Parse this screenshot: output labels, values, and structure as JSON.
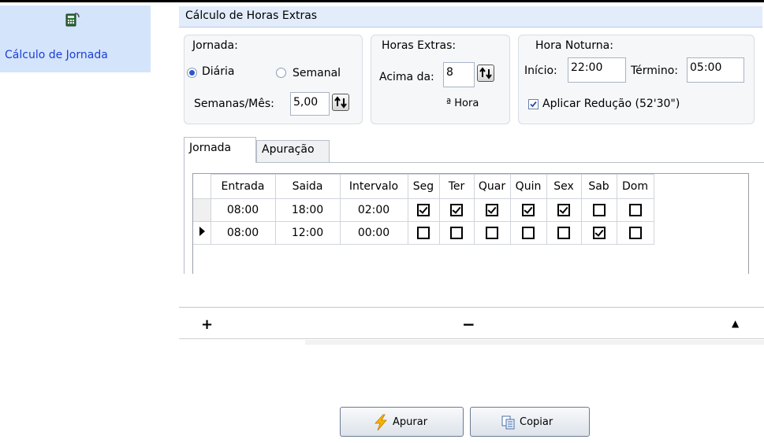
{
  "sidebar": {
    "item_label": "Cálculo de Jornada",
    "item_icon": "calculator-icon"
  },
  "form": {
    "title": "Cálculo de Horas Extras"
  },
  "jornada_group": {
    "label": "Jornada:",
    "option_daily": "Diária",
    "option_weekly": "Semanal",
    "selected": "Diária",
    "weeks_label": "Semanas/Mês:",
    "weeks_value": "5,00"
  },
  "horas_extras_group": {
    "label": "Horas Extras:",
    "above_label": "Acima da:",
    "above_value": "8",
    "hour_suffix": "ª Hora"
  },
  "hora_noturna_group": {
    "label": "Hora Noturna:",
    "start_label": "Início:",
    "start_value": "22:00",
    "end_label": "Término:",
    "end_value": "05:00",
    "apply_reduction_label": "Aplicar Redução (52'30\")",
    "apply_reduction_checked": true
  },
  "tabs": [
    {
      "label": "Jornada",
      "active": true
    },
    {
      "label": "Apuração",
      "active": false
    }
  ],
  "grid": {
    "columns": [
      "Entrada",
      "Saida",
      "Intervalo",
      "Seg",
      "Ter",
      "Quar",
      "Quin",
      "Sex",
      "Sab",
      "Dom"
    ],
    "rows": [
      {
        "entrada": "08:00",
        "saida": "18:00",
        "intervalo": "02:00",
        "days": [
          true,
          true,
          true,
          true,
          true,
          false,
          false
        ],
        "current": false
      },
      {
        "entrada": "08:00",
        "saida": "12:00",
        "intervalo": "00:00",
        "days": [
          false,
          false,
          false,
          false,
          false,
          true,
          false
        ],
        "current": true
      }
    ]
  },
  "nav_controls": {
    "add_symbol": "+",
    "remove_symbol": "−",
    "up_symbol": "▲"
  },
  "buttons": {
    "apurar_label": "Apurar",
    "copiar_label": "Copiar"
  },
  "colors": {
    "sidebar_bg": "#d4e4fb",
    "link_text": "#1a3fd6",
    "title_bar": "#e3ecfa"
  }
}
